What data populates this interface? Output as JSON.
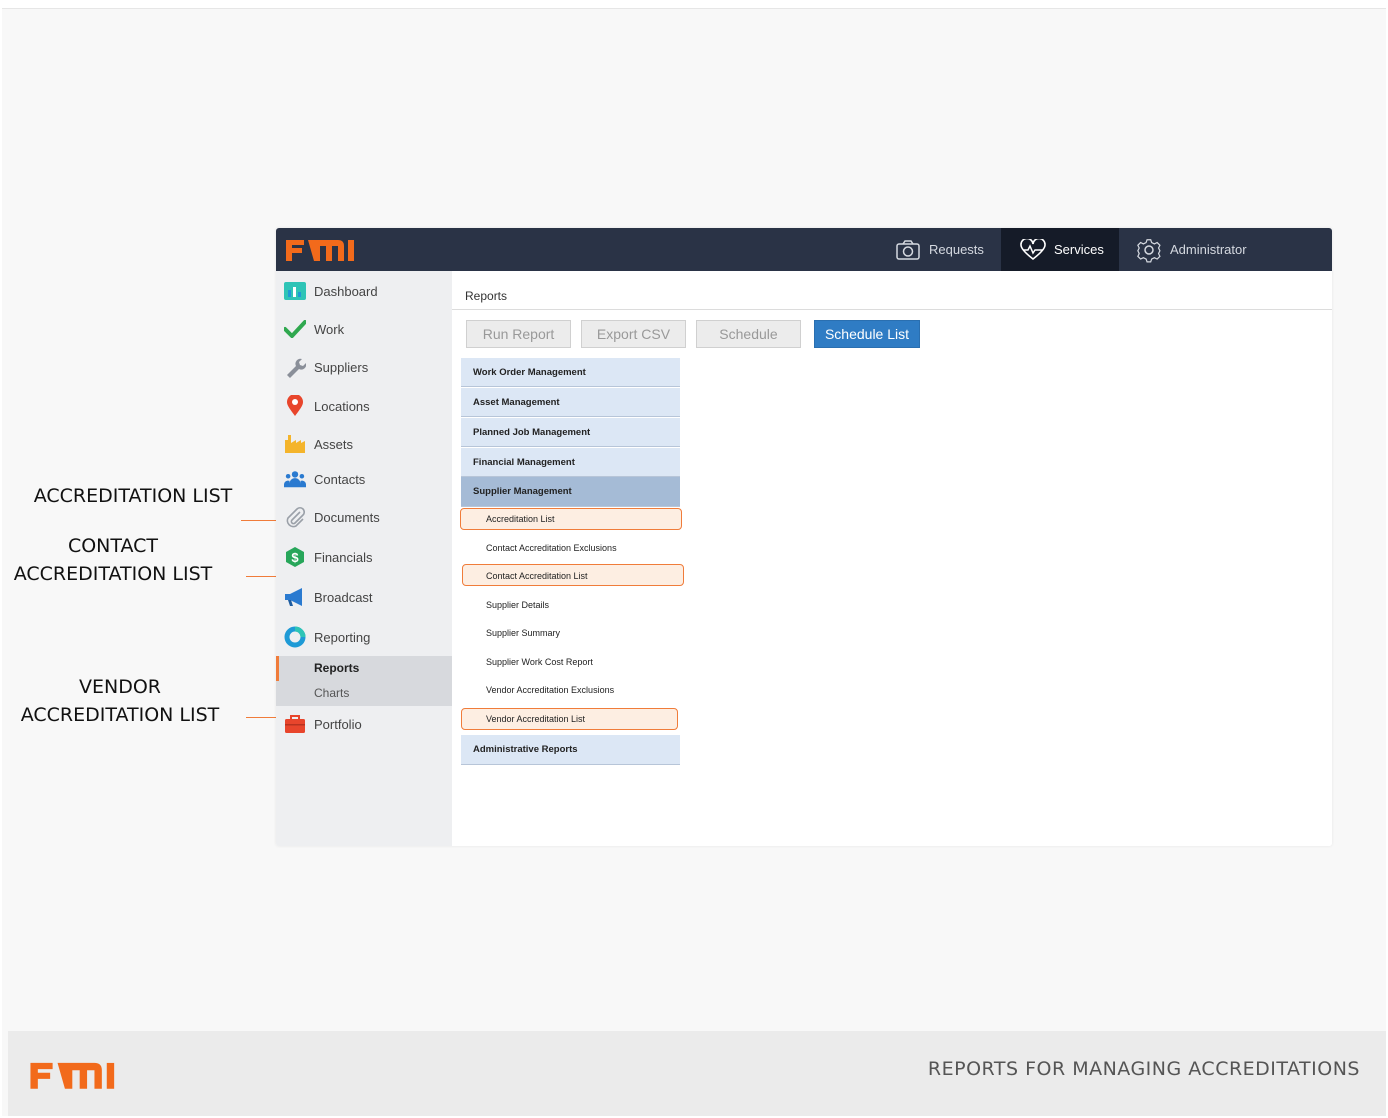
{
  "app": {
    "logo": "FMI",
    "nav": [
      {
        "label": "Requests",
        "icon": "camera-icon"
      },
      {
        "label": "Services",
        "icon": "heartbeat-icon"
      },
      {
        "label": "Administrator",
        "icon": "gear-icon"
      }
    ],
    "sidebar": [
      {
        "label": "Dashboard",
        "icon": "dashboard-icon"
      },
      {
        "label": "Work",
        "icon": "checkmark-icon"
      },
      {
        "label": "Suppliers",
        "icon": "wrench-icon"
      },
      {
        "label": "Locations",
        "icon": "map-pin-icon"
      },
      {
        "label": "Assets",
        "icon": "factory-icon"
      },
      {
        "label": "Contacts",
        "icon": "people-icon"
      },
      {
        "label": "Documents",
        "icon": "paperclip-icon"
      },
      {
        "label": "Financials",
        "icon": "dollar-icon"
      },
      {
        "label": "Broadcast",
        "icon": "megaphone-icon"
      },
      {
        "label": "Reporting",
        "icon": "donut-chart-icon"
      },
      {
        "label": "Portfolio",
        "icon": "briefcase-icon"
      }
    ],
    "reporting_sub": [
      "Reports",
      "Charts"
    ],
    "breadcrumb": "Reports",
    "toolbar": [
      "Run Report",
      "Export CSV",
      "Schedule",
      "Schedule List"
    ],
    "categories": [
      "Work Order Management",
      "Asset Management",
      "Planned Job Management",
      "Financial Management",
      "Supplier Management"
    ],
    "supplier_reports": [
      "Accreditation List",
      "Contact Accreditation Exclusions",
      "Contact Accreditation List",
      "Supplier Details",
      "Supplier Summary",
      "Supplier Work Cost Report",
      "Vendor Accreditation Exclusions",
      "Vendor Accreditation List"
    ],
    "last_category": "Administrative Reports"
  },
  "callouts": {
    "accreditation": "ACCREDITATION LIST",
    "contact_line1": "CONTACT",
    "contact_line2": "ACCREDITATION LIST",
    "vendor_line1": "VENDOR",
    "vendor_line2": "ACCREDITATION LIST"
  },
  "footer": {
    "logo": "FMI",
    "title": "REPORTS FOR MANAGING ACCREDITATIONS"
  },
  "colors": {
    "brand_orange": "#f26a1b",
    "topbar": "#2a3346",
    "primary_button": "#2f7cc4",
    "highlight": "#f07c3a"
  }
}
